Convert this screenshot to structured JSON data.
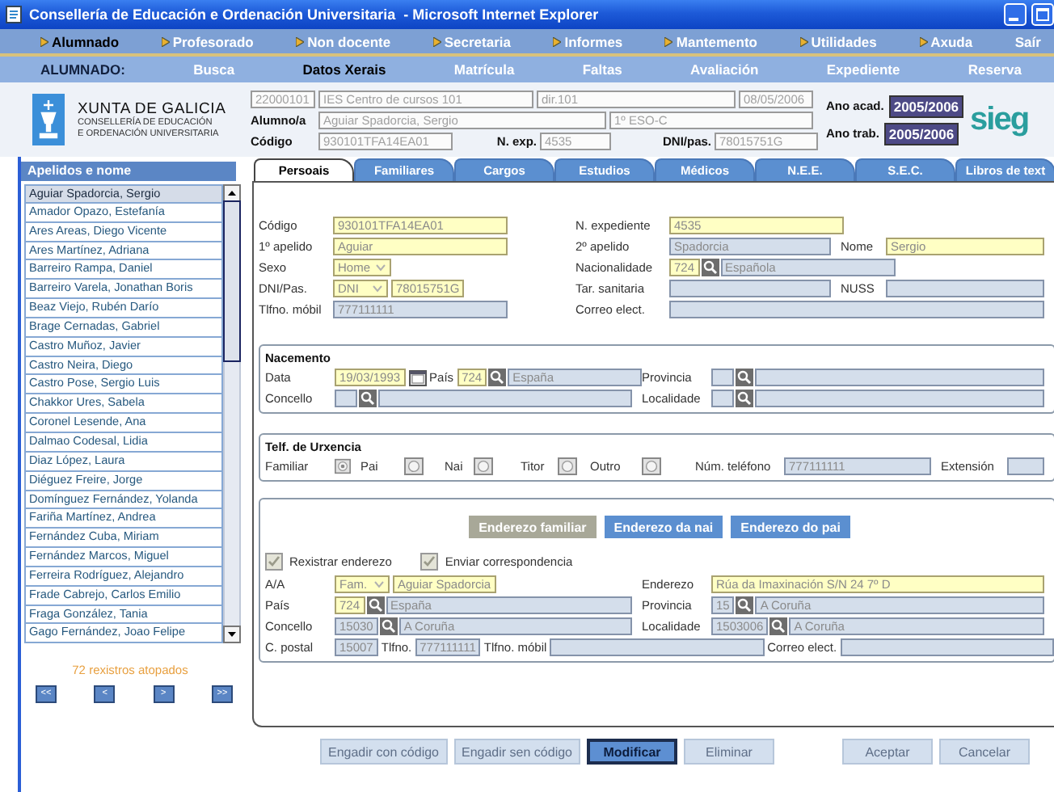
{
  "window": {
    "title": "Consellería de Educación e Ordenación Universitaria  - Microsoft Internet Explorer"
  },
  "main_menu": [
    {
      "label": "Alumnado",
      "selected": true,
      "bullet": true
    },
    {
      "label": "Profesorado",
      "selected": false,
      "bullet": true
    },
    {
      "label": "Non docente",
      "selected": false,
      "bullet": true
    },
    {
      "label": "Secretaria",
      "selected": false,
      "bullet": true
    },
    {
      "label": "Informes",
      "selected": false,
      "bullet": true
    },
    {
      "label": "Mantemento",
      "selected": false,
      "bullet": true
    },
    {
      "label": "Utilidades",
      "selected": false,
      "bullet": true
    },
    {
      "label": "Axuda",
      "selected": false,
      "bullet": true
    },
    {
      "label": "Saír",
      "selected": false,
      "bullet": false
    }
  ],
  "section_menu": {
    "label": "ALUMNADO:",
    "items": [
      {
        "label": "Busca",
        "selected": false
      },
      {
        "label": "Datos Xerais",
        "selected": true
      },
      {
        "label": "Matrícula",
        "selected": false
      },
      {
        "label": "Faltas",
        "selected": false
      },
      {
        "label": "Avaliación",
        "selected": false
      },
      {
        "label": "Expediente",
        "selected": false
      },
      {
        "label": "Reserva",
        "selected": false
      }
    ]
  },
  "header": {
    "org": {
      "title": "XUNTA DE GALICIA",
      "lines": [
        "CONSELLERÍA DE EDUCACIÓN",
        "E ORDENACIÓN UNIVERSITARIA"
      ]
    },
    "centre": {
      "code": "22000101",
      "name": "IES Centro de cursos 101",
      "address": "dir.101",
      "date": "08/05/2006"
    },
    "student": {
      "label": "Alumno/a",
      "name": "Aguiar Spadorcia, Sergio",
      "group": "1º ESO-C"
    },
    "ids": [
      {
        "label": "Código",
        "value": "930101TFA14EA01"
      },
      {
        "label": "N. exp.",
        "value": "4535"
      },
      {
        "label": "DNI/pas.",
        "value": "78015751G"
      }
    ],
    "years": [
      {
        "label": "Ano acad.",
        "value": "2005/2006"
      },
      {
        "label": "Ano trab.",
        "value": "2005/2006"
      }
    ],
    "logo": "sieg"
  },
  "student_list": {
    "heading": "Apelidos e nome",
    "rows": [
      {
        "name": "Aguiar Spadorcia, Sergio",
        "selected": true
      },
      {
        "name": "Amador Opazo, Estefanía",
        "selected": false
      },
      {
        "name": "Ares Areas, Diego Vicente",
        "selected": false
      },
      {
        "name": "Ares Martínez, Adriana",
        "selected": false
      },
      {
        "name": "Barreiro Rampa, Daniel",
        "selected": false
      },
      {
        "name": "Barreiro Varela, Jonathan Boris",
        "selected": false
      },
      {
        "name": "Beaz Viejo, Rubén Darío",
        "selected": false
      },
      {
        "name": "Brage Cernadas, Gabriel",
        "selected": false
      },
      {
        "name": "Castro Muñoz, Javier",
        "selected": false
      },
      {
        "name": "Castro Neira, Diego",
        "selected": false
      },
      {
        "name": "Castro Pose, Sergio Luis",
        "selected": false
      },
      {
        "name": "Chakkor Ures, Sabela",
        "selected": false
      },
      {
        "name": "Coronel Lesende, Ana",
        "selected": false
      },
      {
        "name": "Dalmao Codesal, Lidia",
        "selected": false
      },
      {
        "name": "Diaz López, Laura",
        "selected": false
      },
      {
        "name": "Diéguez Freire, Jorge",
        "selected": false
      },
      {
        "name": "Domínguez Fernández, Yolanda",
        "selected": false
      },
      {
        "name": "Fariña Martínez, Andrea",
        "selected": false
      },
      {
        "name": "Fernández Cuba, Miriam",
        "selected": false
      },
      {
        "name": "Fernández Marcos, Miguel",
        "selected": false
      },
      {
        "name": "Ferreira Rodríguez, Alejandro",
        "selected": false
      },
      {
        "name": "Frade Cabrejo, Carlos Emilio",
        "selected": false
      },
      {
        "name": "Fraga González, Tania",
        "selected": false
      },
      {
        "name": "Gago Fernández, Joao Felipe",
        "selected": false
      }
    ],
    "count": "72 rexistros atopados",
    "pager": [
      "<<",
      "<",
      ">",
      ">>"
    ]
  },
  "tabs": [
    {
      "label": "Persoais",
      "selected": true
    },
    {
      "label": "Familiares",
      "selected": false
    },
    {
      "label": "Cargos",
      "selected": false
    },
    {
      "label": "Estudios",
      "selected": false
    },
    {
      "label": "Médicos",
      "selected": false
    },
    {
      "label": "N.E.E.",
      "selected": false
    },
    {
      "label": "S.E.C.",
      "selected": false
    },
    {
      "label": "Libros de text",
      "selected": false
    }
  ],
  "personal": {
    "rows": [
      [
        [
          {
            "kind": "label",
            "text": "Código"
          }
        ],
        [
          {
            "kind": "text",
            "value": "930101TFA14EA01",
            "required": true
          }
        ],
        [
          {
            "kind": "label",
            "text": "N. expediente"
          }
        ],
        [
          {
            "kind": "text",
            "value": "4535",
            "required": true
          }
        ]
      ],
      [
        [
          {
            "kind": "label",
            "text": "1º apelido"
          }
        ],
        [
          {
            "kind": "text",
            "value": "Aguiar",
            "required": true
          }
        ],
        [
          {
            "kind": "label",
            "text": "2º apelido"
          }
        ],
        [
          {
            "kind": "text",
            "value": "Spadorcia",
            "required": false
          }
        ],
        [
          {
            "kind": "label",
            "text": "Nome"
          }
        ],
        [
          {
            "kind": "text",
            "value": "Sergio",
            "required": true
          }
        ]
      ],
      [
        [
          {
            "kind": "label",
            "text": "Sexo"
          }
        ],
        [
          {
            "kind": "select",
            "value": "Home",
            "required": true
          }
        ],
        [
          {
            "kind": "label",
            "text": "Nacionalidade"
          }
        ],
        [
          {
            "kind": "lookup",
            "code": "724",
            "name": "Española",
            "required": true
          }
        ]
      ],
      [
        [
          {
            "kind": "label",
            "text": "DNI/Pas."
          }
        ],
        [
          {
            "kind": "select",
            "value": "DNI",
            "required": true
          },
          {
            "kind": "text",
            "value": "78015751G",
            "required": true
          }
        ],
        [
          {
            "kind": "label",
            "text": "Tar. sanitaria"
          }
        ],
        [
          {
            "kind": "text",
            "required": false
          }
        ],
        [
          {
            "kind": "label",
            "text": "NUSS"
          }
        ],
        [
          {
            "kind": "text",
            "required": false
          }
        ]
      ],
      [
        [
          {
            "kind": "label",
            "text": "Tlfno. móbil"
          }
        ],
        [
          {
            "kind": "text",
            "value": "777111111",
            "required": false
          }
        ],
        [
          {
            "kind": "label",
            "text": "Correo elect."
          }
        ],
        [
          {
            "kind": "text",
            "required": false
          }
        ]
      ]
    ]
  },
  "birth": {
    "title": "Nacemento",
    "rows": [
      [
        [
          {
            "kind": "label",
            "text": "Data"
          }
        ],
        [
          {
            "kind": "date",
            "value": "19/03/1993",
            "required": true
          },
          {
            "kind": "label",
            "text": "País"
          },
          {
            "kind": "lookup",
            "code": "724",
            "name": "España",
            "required": true
          }
        ],
        [
          {
            "kind": "label",
            "text": "Provincia"
          }
        ],
        [
          {
            "kind": "lookup",
            "required": false
          }
        ]
      ],
      [
        [
          {
            "kind": "label",
            "text": "Concello"
          }
        ],
        [
          {
            "kind": "lookup",
            "required": false
          }
        ],
        [
          {
            "kind": "label",
            "text": "Localidade"
          }
        ],
        [
          {
            "kind": "lookup",
            "required": false
          }
        ]
      ]
    ]
  },
  "emergency": {
    "title": "Telf. de Urxencia",
    "rows": [
      [
        [
          {
            "kind": "label",
            "text": "Familiar"
          }
        ],
        [
          {
            "kind": "radio",
            "selected": true
          }
        ],
        [
          {
            "kind": "label",
            "text": "Pai"
          }
        ],
        [
          {
            "kind": "radio",
            "selected": false
          }
        ],
        [
          {
            "kind": "label",
            "text": "Nai"
          }
        ],
        [
          {
            "kind": "radio",
            "selected": false
          }
        ],
        [
          {
            "kind": "label",
            "text": "Titor"
          }
        ],
        [
          {
            "kind": "radio",
            "selected": false
          }
        ],
        [
          {
            "kind": "label",
            "text": "Outro"
          }
        ],
        [
          {
            "kind": "radio",
            "selected": false
          }
        ],
        [
          {
            "kind": "label",
            "text": "Núm. teléfono"
          }
        ],
        [
          {
            "kind": "text",
            "value": "777111111",
            "required": false
          }
        ],
        [
          {
            "kind": "label",
            "text": "Extensión"
          }
        ],
        [
          {
            "kind": "text",
            "required": false
          }
        ]
      ]
    ]
  },
  "address": {
    "buttons": [
      {
        "label": "Enderezo familiar",
        "selected": true
      },
      {
        "label": "Enderezo da nai",
        "selected": false
      },
      {
        "label": "Enderezo do pai",
        "selected": false
      }
    ],
    "checkboxes": [
      {
        "label": "Rexistrar enderezo",
        "checked": true
      },
      {
        "label": "Enviar correspondencia",
        "checked": true
      }
    ],
    "rows": [
      [
        [
          {
            "kind": "label",
            "text": "A/A"
          }
        ],
        [
          {
            "kind": "select",
            "value": "Fam.",
            "required": true
          },
          {
            "kind": "text",
            "value": "Aguiar Spadorcia",
            "required": true
          }
        ],
        [
          {
            "kind": "label",
            "text": "Enderezo"
          }
        ],
        [
          {
            "kind": "text",
            "value": "Rúa da Imaxinación S/N 24 7º D",
            "required": true
          }
        ]
      ],
      [
        [
          {
            "kind": "label",
            "text": "País"
          }
        ],
        [
          {
            "kind": "lookup",
            "code": "724",
            "name": "España",
            "required": true
          }
        ],
        [
          {
            "kind": "label",
            "text": "Provincia"
          }
        ],
        [
          {
            "kind": "lookup",
            "code": "15",
            "name": "A Coruña",
            "required": false
          }
        ]
      ],
      [
        [
          {
            "kind": "label",
            "text": "Concello"
          }
        ],
        [
          {
            "kind": "lookup",
            "code": "15030",
            "name": "A Coruña",
            "required": false
          }
        ],
        [
          {
            "kind": "label",
            "text": "Localidade"
          }
        ],
        [
          {
            "kind": "lookup",
            "code": "1503006",
            "name": "A Coruña",
            "required": false
          }
        ]
      ],
      [
        [
          {
            "kind": "label",
            "text": "C. postal"
          }
        ],
        [
          {
            "kind": "text",
            "value": "15007",
            "required": false
          },
          {
            "kind": "label",
            "text": "Tlfno."
          },
          {
            "kind": "text",
            "value": "777111111",
            "required": false
          },
          {
            "kind": "label",
            "text": "Tlfno. móbil"
          },
          {
            "kind": "text",
            "required": false
          },
          {
            "kind": "label",
            "text": "Correo elect."
          },
          {
            "kind": "text",
            "required": false
          }
        ]
      ]
    ]
  },
  "record_actions": [
    {
      "label": "Engadir con código",
      "disabled": true
    },
    {
      "label": "Engadir sen código",
      "disabled": true
    },
    {
      "label": "Modificar",
      "disabled": false
    },
    {
      "label": "Eliminar",
      "disabled": true
    }
  ],
  "confirm_actions": [
    {
      "label": "Aceptar",
      "disabled": true
    },
    {
      "label": "Cancelar",
      "disabled": true
    }
  ]
}
